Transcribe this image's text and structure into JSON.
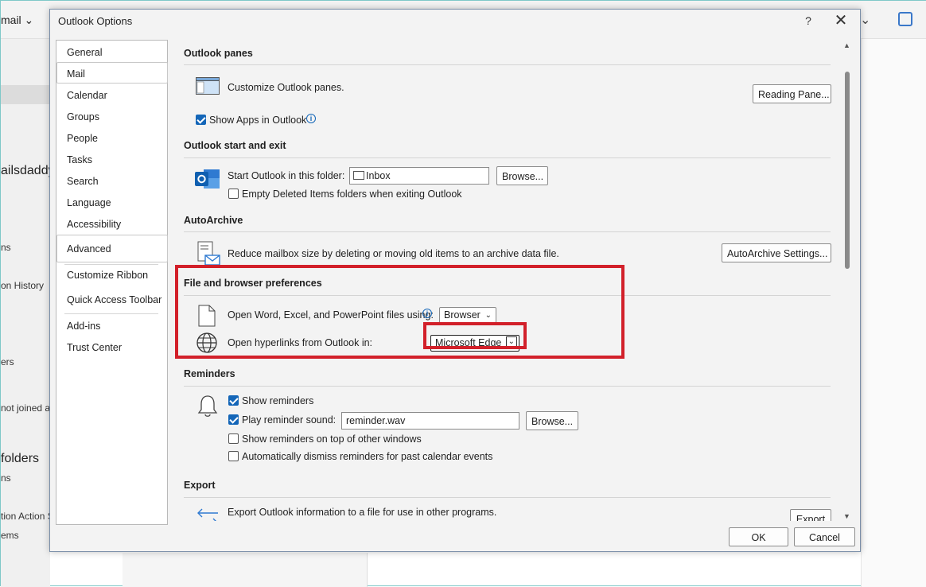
{
  "background": {
    "mail_dropdown": "mail",
    "left_texts": [
      "ailsdaddy",
      "ns",
      "on History",
      "ers",
      "not joined a",
      "folders",
      "ns",
      "tion Action S",
      "ems"
    ]
  },
  "dialog": {
    "title": "Outlook Options",
    "help_label": "?",
    "close_label": "✕",
    "nav": [
      "General",
      "Mail",
      "Calendar",
      "Groups",
      "People",
      "Tasks",
      "Search",
      "Language",
      "Accessibility",
      "Advanced",
      "Customize Ribbon",
      "Quick Access Toolbar",
      "Add-ins",
      "Trust Center"
    ],
    "sections": {
      "panes": {
        "header": "Outlook panes",
        "desc": "Customize Outlook panes.",
        "button": "Reading Pane...",
        "show_apps": "Show Apps in Outlook"
      },
      "start": {
        "header": "Outlook start and exit",
        "start_folder_label": "Start Outlook in this folder:",
        "start_folder_value": "Inbox",
        "browse": "Browse...",
        "empty_deleted": "Empty Deleted Items folders when exiting Outlook"
      },
      "archive": {
        "header": "AutoArchive",
        "desc": "Reduce mailbox size by deleting or moving old items to an archive data file.",
        "button": "AutoArchive Settings..."
      },
      "file_browser": {
        "header": "File and browser preferences",
        "open_files_label": "Open Word, Excel, and PowerPoint files using:",
        "open_files_value": "Browser",
        "hyperlinks_label": "Open hyperlinks from Outlook in:",
        "hyperlinks_value": "Microsoft Edge"
      },
      "reminders": {
        "header": "Reminders",
        "show": "Show reminders",
        "play_sound": "Play reminder sound:",
        "sound_file": "reminder.wav",
        "browse": "Browse...",
        "on_top": "Show reminders on top of other windows",
        "auto_dismiss": "Automatically dismiss reminders for past calendar events"
      },
      "export": {
        "header": "Export",
        "desc": "Export Outlook information to a file for use in other programs.",
        "button": "Export"
      }
    },
    "ok": "OK",
    "cancel": "Cancel",
    "colors": {
      "highlight": "#d2202a",
      "accent": "#1466b8"
    }
  }
}
